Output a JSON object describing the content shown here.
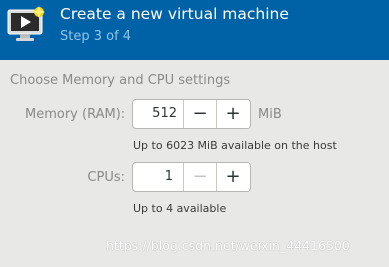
{
  "header": {
    "title": "Create a new virtual machine",
    "step": "Step 3 of 4",
    "colors": {
      "background": "#0062a6",
      "title": "#ffffff",
      "step": "#8fc3ea"
    },
    "icon": "virtual-machine-monitor-icon"
  },
  "section": {
    "title": "Choose Memory and CPU settings"
  },
  "memory": {
    "label": "Memory (RAM):",
    "value": "512",
    "decrement_symbol": "−",
    "increment_symbol": "+",
    "unit": "MiB",
    "hint": "Up to 6023 MiB available on the host"
  },
  "cpus": {
    "label": "CPUs:",
    "value": "1",
    "decrement_symbol": "−",
    "increment_symbol": "+",
    "hint": "Up to 4 available"
  },
  "watermark": {
    "text": "https://blog.csdn.net/weixin_44416500"
  }
}
